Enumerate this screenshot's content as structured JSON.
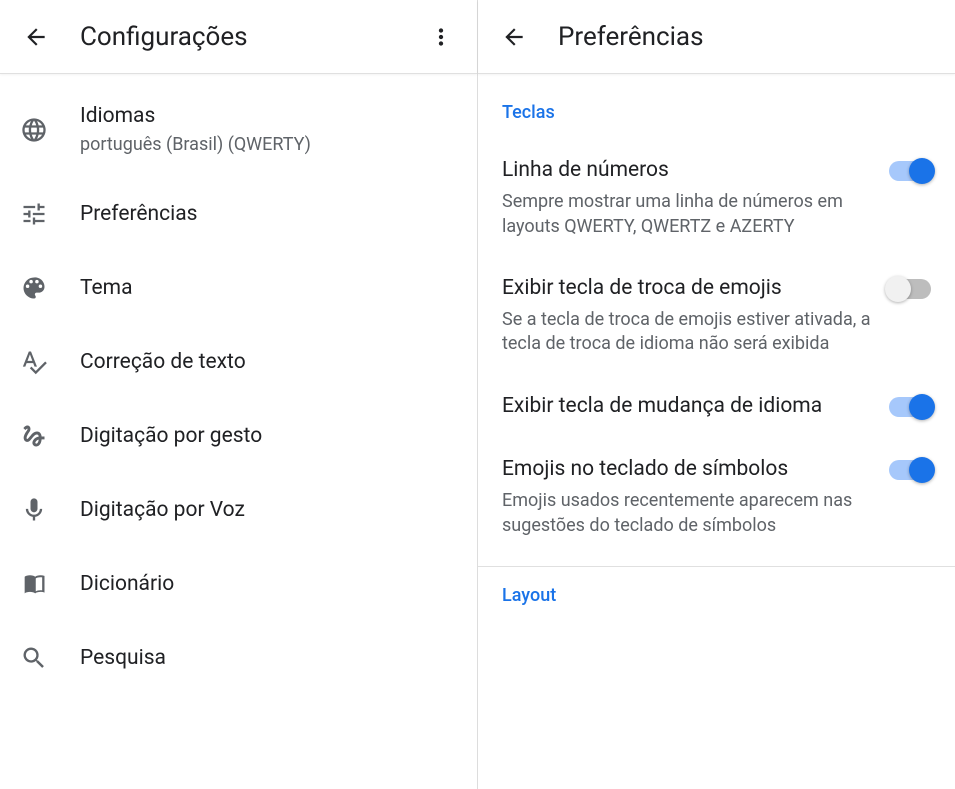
{
  "left": {
    "title": "Configurações",
    "items": [
      {
        "label": "Idiomas",
        "sub": "português (Brasil) (QWERTY)",
        "icon": "globe"
      },
      {
        "label": "Preferências",
        "icon": "sliders"
      },
      {
        "label": "Tema",
        "icon": "palette"
      },
      {
        "label": "Correção de texto",
        "icon": "spellcheck"
      },
      {
        "label": "Digitação por gesto",
        "icon": "gesture"
      },
      {
        "label": "Digitação por Voz",
        "icon": "mic"
      },
      {
        "label": "Dicionário",
        "icon": "book"
      },
      {
        "label": "Pesquisa",
        "icon": "search"
      }
    ]
  },
  "right": {
    "title": "Preferências",
    "section1": "Teclas",
    "items": [
      {
        "title": "Linha de números",
        "desc": "Sempre mostrar uma linha de números em layouts QWERTY, QWERTZ e AZERTY",
        "on": true
      },
      {
        "title": "Exibir tecla de troca de emojis",
        "desc": "Se a tecla de troca de emojis estiver ativada, a tecla de troca de idioma não será exibida",
        "on": false
      },
      {
        "title": "Exibir tecla de mudança de idioma",
        "desc": "",
        "on": true
      },
      {
        "title": "Emojis no teclado de símbolos",
        "desc": "Emojis usados recentemente aparecem nas sugestões do teclado de símbolos",
        "on": true
      }
    ],
    "section2": "Layout"
  }
}
